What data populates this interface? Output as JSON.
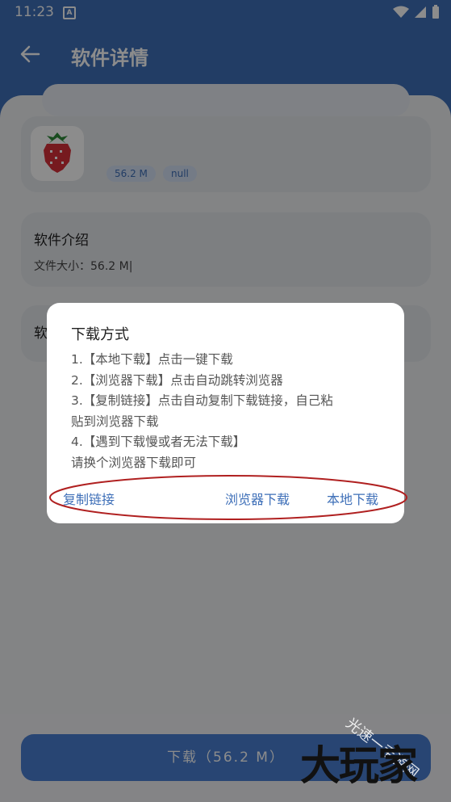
{
  "status_bar": {
    "time": "11:23",
    "notification_badge": "A"
  },
  "header": {
    "title": "软件详情",
    "back_icon": "arrow-left-icon"
  },
  "app": {
    "size_tag": "56.2 M",
    "version_tag": "null",
    "icon": "strawberry-icon"
  },
  "intro": {
    "title": "软件介绍",
    "file_size": "文件大小：56.2 M|"
  },
  "third_card": {
    "label": "软"
  },
  "dialog": {
    "title": "下载方式",
    "lines": [
      "1.【本地下载】点击一键下载",
      "2.【浏览器下载】点击自动跳转浏览器",
      "3.【复制链接】点击自动复制下载链接，自己粘",
      "贴到浏览器下载",
      "4.【遇到下载慢或者无法下载】",
      "请换个浏览器下载即可"
    ],
    "buttons": {
      "copy_link": "复制链接",
      "browser_download": "浏览器下载",
      "local_download": "本地下载"
    }
  },
  "download_button": "下载（56.2 M）",
  "watermark": {
    "big": "大玩家",
    "small": "光速一手游网"
  },
  "colors": {
    "primary": "#3e6fb8",
    "button": "#4a7fd1",
    "annotation": "#b02020"
  }
}
